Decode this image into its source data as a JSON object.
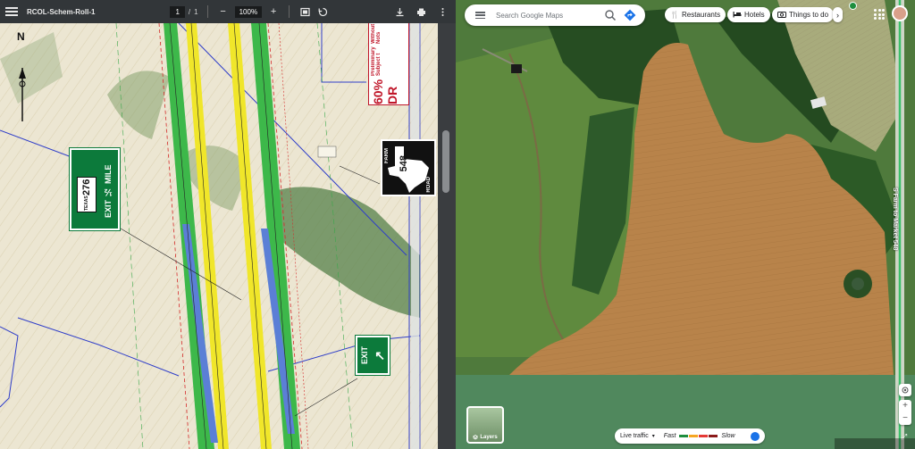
{
  "pdf": {
    "title": "RCOL-Schem-Roll-1",
    "page_current": "1",
    "page_sep": "/",
    "page_total": "1",
    "zoom_value": "100%",
    "zoom_out_glyph": "−",
    "zoom_in_glyph": "+",
    "icons": [
      "menu-icon",
      "fit-page-icon",
      "rotate-icon",
      "download-icon",
      "print-icon",
      "more-icon"
    ],
    "compass_letter": "N",
    "sign_exit_half": {
      "shield_top": "TEXAS",
      "shield_number": "276",
      "line1": "EXIT",
      "fraction": "½",
      "line2": "MILE"
    },
    "sign_farm_road": {
      "left_word": "FARM",
      "number": "548",
      "right_word": "ROAD"
    },
    "sign_exit_arrow": {
      "text": "EXIT",
      "arrow": "↖"
    },
    "preliminary_note": {
      "line1": "60% DR",
      "line2": "Preliminary Subject t",
      "line3": "Without Nots"
    },
    "colors": {
      "green_lane": "#3db84a",
      "yellow_lane": "#f0e62a",
      "blue_lane": "#5b7fd6",
      "sign_green": "#0c7a3b",
      "note_red": "#c0172a"
    }
  },
  "map": {
    "search_placeholder": "Search Google Maps",
    "chips": [
      {
        "icon": "fork-knife-icon",
        "label": "Restaurants"
      },
      {
        "icon": "bed-icon",
        "label": "Hotels"
      },
      {
        "icon": "camera-icon",
        "label": "Things to do"
      }
    ],
    "road_label": "S Farm to Market 548",
    "layers_label": "Layers",
    "traffic": {
      "label": "Live traffic",
      "fast": "Fast",
      "slow": "Slow"
    },
    "colors": {
      "field_orange": "#b8834a",
      "trees": "#2d5a2a",
      "grass": "#6b8e3e"
    }
  }
}
